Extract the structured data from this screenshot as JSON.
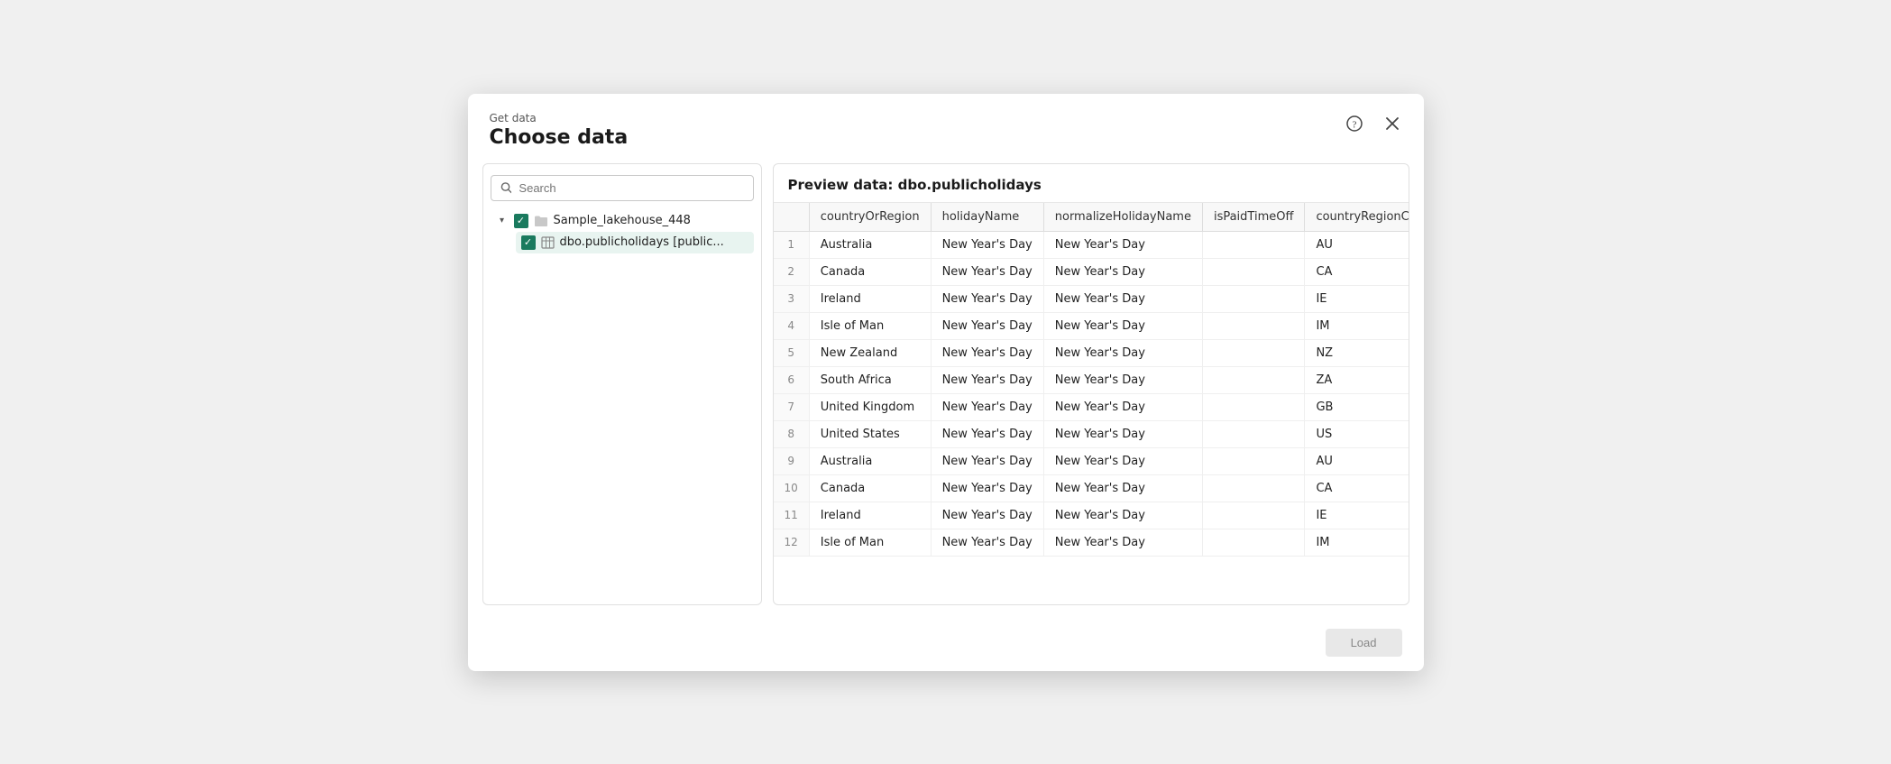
{
  "dialog": {
    "get_data_label": "Get data",
    "title": "Choose data",
    "help_icon": "?",
    "close_icon": "✕"
  },
  "search": {
    "placeholder": "Search"
  },
  "tree": {
    "lakehouse": {
      "label": "Sample_lakehouse_448",
      "expanded": true,
      "checked": true
    },
    "table": {
      "label": "dbo.publicholidays [public...",
      "checked": true
    }
  },
  "preview": {
    "title": "Preview data: dbo.publicholidays",
    "columns": [
      {
        "id": "row_num",
        "label": ""
      },
      {
        "id": "countryOrRegion",
        "label": "countryOrRegion"
      },
      {
        "id": "holidayName",
        "label": "holidayName"
      },
      {
        "id": "normalizeHolidayName",
        "label": "normalizeHolidayName"
      },
      {
        "id": "isPaidTimeOff",
        "label": "isPaidTimeOff"
      },
      {
        "id": "countryRegionCode",
        "label": "countryRegionCode"
      }
    ],
    "rows": [
      {
        "row_num": "1",
        "countryOrRegion": "Australia",
        "holidayName": "New Year's Day",
        "normalizeHolidayName": "New Year's Day",
        "isPaidTimeOff": "",
        "countryRegionCode": "AU"
      },
      {
        "row_num": "2",
        "countryOrRegion": "Canada",
        "holidayName": "New Year's Day",
        "normalizeHolidayName": "New Year's Day",
        "isPaidTimeOff": "",
        "countryRegionCode": "CA"
      },
      {
        "row_num": "3",
        "countryOrRegion": "Ireland",
        "holidayName": "New Year's Day",
        "normalizeHolidayName": "New Year's Day",
        "isPaidTimeOff": "",
        "countryRegionCode": "IE"
      },
      {
        "row_num": "4",
        "countryOrRegion": "Isle of Man",
        "holidayName": "New Year's Day",
        "normalizeHolidayName": "New Year's Day",
        "isPaidTimeOff": "",
        "countryRegionCode": "IM"
      },
      {
        "row_num": "5",
        "countryOrRegion": "New Zealand",
        "holidayName": "New Year's Day",
        "normalizeHolidayName": "New Year's Day",
        "isPaidTimeOff": "",
        "countryRegionCode": "NZ"
      },
      {
        "row_num": "6",
        "countryOrRegion": "South Africa",
        "holidayName": "New Year's Day",
        "normalizeHolidayName": "New Year's Day",
        "isPaidTimeOff": "",
        "countryRegionCode": "ZA"
      },
      {
        "row_num": "7",
        "countryOrRegion": "United Kingdom",
        "holidayName": "New Year's Day",
        "normalizeHolidayName": "New Year's Day",
        "isPaidTimeOff": "",
        "countryRegionCode": "GB"
      },
      {
        "row_num": "8",
        "countryOrRegion": "United States",
        "holidayName": "New Year's Day",
        "normalizeHolidayName": "New Year's Day",
        "isPaidTimeOff": "",
        "countryRegionCode": "US"
      },
      {
        "row_num": "9",
        "countryOrRegion": "Australia",
        "holidayName": "New Year's Day",
        "normalizeHolidayName": "New Year's Day",
        "isPaidTimeOff": "",
        "countryRegionCode": "AU"
      },
      {
        "row_num": "10",
        "countryOrRegion": "Canada",
        "holidayName": "New Year's Day",
        "normalizeHolidayName": "New Year's Day",
        "isPaidTimeOff": "",
        "countryRegionCode": "CA"
      },
      {
        "row_num": "11",
        "countryOrRegion": "Ireland",
        "holidayName": "New Year's Day",
        "normalizeHolidayName": "New Year's Day",
        "isPaidTimeOff": "",
        "countryRegionCode": "IE"
      },
      {
        "row_num": "12",
        "countryOrRegion": "Isle of Man",
        "holidayName": "New Year's Day",
        "normalizeHolidayName": "New Year's Day",
        "isPaidTimeOff": "",
        "countryRegionCode": "IM"
      }
    ]
  },
  "footer": {
    "load_label": "Load"
  }
}
